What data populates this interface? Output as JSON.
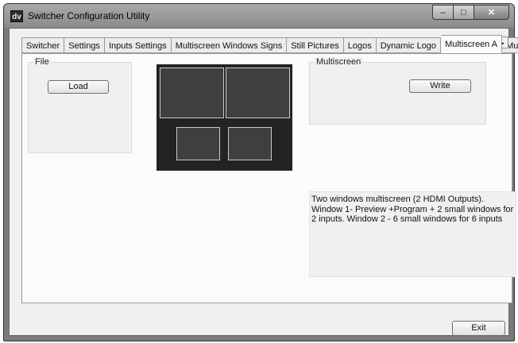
{
  "window": {
    "app_icon_text": "dv",
    "title": "Switcher Configuration Utility",
    "controls": {
      "minimize": "–",
      "maximize": "□",
      "close": "✕"
    }
  },
  "tabs": [
    {
      "label": "Switcher",
      "active": false
    },
    {
      "label": "Settings",
      "active": false
    },
    {
      "label": "Inputs Settings",
      "active": false
    },
    {
      "label": "Multiscreen Windows Signs",
      "active": false
    },
    {
      "label": "Still Pictures",
      "active": false
    },
    {
      "label": "Logos",
      "active": false
    },
    {
      "label": "Dynamic Logo",
      "active": false
    },
    {
      "label": "Multiscreen A",
      "active": true
    },
    {
      "label": "Mult",
      "active": false
    }
  ],
  "tab_scroll": {
    "left": "◄",
    "right": "►"
  },
  "file_group": {
    "label": "File",
    "load_button": "Load"
  },
  "multiscreen_group": {
    "label": "Multiscreen",
    "write_button": "Write"
  },
  "description": "Two windows multiscreen  (2 HDMI Outputs).  Window 1- Preview +Program + 2 small windows for 2 inputs. Window 2 - 6 small windows for 6 inputs",
  "exit_button": "Exit",
  "icons": {
    "app": "app-logo-icon",
    "min": "minimize-icon",
    "max": "maximize-icon",
    "close": "close-icon"
  }
}
